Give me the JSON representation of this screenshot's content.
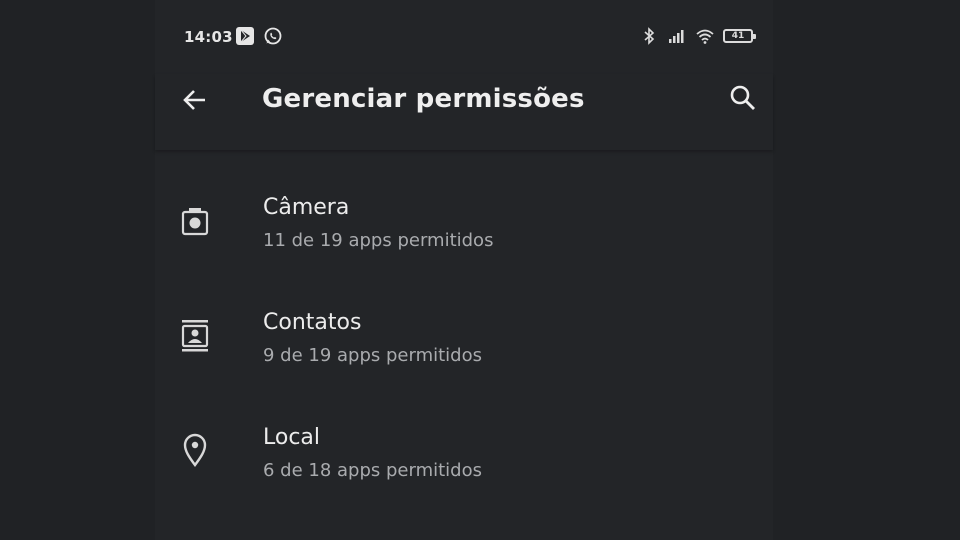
{
  "status_bar": {
    "time": "14:03",
    "left_icons": [
      "play-store-icon",
      "whatsapp-icon"
    ],
    "right_icons": [
      "bluetooth-icon",
      "signal-icon",
      "wifi-icon",
      "battery-icon"
    ],
    "battery_level": "41"
  },
  "app_bar": {
    "title": "Gerenciar permissões",
    "back_icon": "arrow-left-icon",
    "search_icon": "search-icon"
  },
  "permissions": [
    {
      "icon": "camera-icon",
      "title": "Câmera",
      "subtitle": "11 de 19 apps permitidos"
    },
    {
      "icon": "contacts-icon",
      "title": "Contatos",
      "subtitle": "9 de 19 apps permitidos"
    },
    {
      "icon": "location-icon",
      "title": "Local",
      "subtitle": "6 de 18 apps permitidos"
    }
  ],
  "colors": {
    "background": "#202225",
    "text_primary": "#ececec",
    "text_secondary": "#a9abae"
  }
}
